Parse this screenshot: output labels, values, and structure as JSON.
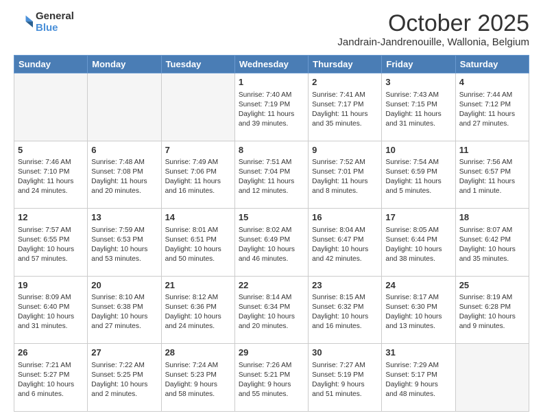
{
  "header": {
    "logo_general": "General",
    "logo_blue": "Blue",
    "month_title": "October 2025",
    "location": "Jandrain-Jandrenouille, Wallonia, Belgium"
  },
  "days_of_week": [
    "Sunday",
    "Monday",
    "Tuesday",
    "Wednesday",
    "Thursday",
    "Friday",
    "Saturday"
  ],
  "weeks": [
    [
      {
        "day": "",
        "info": ""
      },
      {
        "day": "",
        "info": ""
      },
      {
        "day": "",
        "info": ""
      },
      {
        "day": "1",
        "info": "Sunrise: 7:40 AM\nSunset: 7:19 PM\nDaylight: 11 hours\nand 39 minutes."
      },
      {
        "day": "2",
        "info": "Sunrise: 7:41 AM\nSunset: 7:17 PM\nDaylight: 11 hours\nand 35 minutes."
      },
      {
        "day": "3",
        "info": "Sunrise: 7:43 AM\nSunset: 7:15 PM\nDaylight: 11 hours\nand 31 minutes."
      },
      {
        "day": "4",
        "info": "Sunrise: 7:44 AM\nSunset: 7:12 PM\nDaylight: 11 hours\nand 27 minutes."
      }
    ],
    [
      {
        "day": "5",
        "info": "Sunrise: 7:46 AM\nSunset: 7:10 PM\nDaylight: 11 hours\nand 24 minutes."
      },
      {
        "day": "6",
        "info": "Sunrise: 7:48 AM\nSunset: 7:08 PM\nDaylight: 11 hours\nand 20 minutes."
      },
      {
        "day": "7",
        "info": "Sunrise: 7:49 AM\nSunset: 7:06 PM\nDaylight: 11 hours\nand 16 minutes."
      },
      {
        "day": "8",
        "info": "Sunrise: 7:51 AM\nSunset: 7:04 PM\nDaylight: 11 hours\nand 12 minutes."
      },
      {
        "day": "9",
        "info": "Sunrise: 7:52 AM\nSunset: 7:01 PM\nDaylight: 11 hours\nand 8 minutes."
      },
      {
        "day": "10",
        "info": "Sunrise: 7:54 AM\nSunset: 6:59 PM\nDaylight: 11 hours\nand 5 minutes."
      },
      {
        "day": "11",
        "info": "Sunrise: 7:56 AM\nSunset: 6:57 PM\nDaylight: 11 hours\nand 1 minute."
      }
    ],
    [
      {
        "day": "12",
        "info": "Sunrise: 7:57 AM\nSunset: 6:55 PM\nDaylight: 10 hours\nand 57 minutes."
      },
      {
        "day": "13",
        "info": "Sunrise: 7:59 AM\nSunset: 6:53 PM\nDaylight: 10 hours\nand 53 minutes."
      },
      {
        "day": "14",
        "info": "Sunrise: 8:01 AM\nSunset: 6:51 PM\nDaylight: 10 hours\nand 50 minutes."
      },
      {
        "day": "15",
        "info": "Sunrise: 8:02 AM\nSunset: 6:49 PM\nDaylight: 10 hours\nand 46 minutes."
      },
      {
        "day": "16",
        "info": "Sunrise: 8:04 AM\nSunset: 6:47 PM\nDaylight: 10 hours\nand 42 minutes."
      },
      {
        "day": "17",
        "info": "Sunrise: 8:05 AM\nSunset: 6:44 PM\nDaylight: 10 hours\nand 38 minutes."
      },
      {
        "day": "18",
        "info": "Sunrise: 8:07 AM\nSunset: 6:42 PM\nDaylight: 10 hours\nand 35 minutes."
      }
    ],
    [
      {
        "day": "19",
        "info": "Sunrise: 8:09 AM\nSunset: 6:40 PM\nDaylight: 10 hours\nand 31 minutes."
      },
      {
        "day": "20",
        "info": "Sunrise: 8:10 AM\nSunset: 6:38 PM\nDaylight: 10 hours\nand 27 minutes."
      },
      {
        "day": "21",
        "info": "Sunrise: 8:12 AM\nSunset: 6:36 PM\nDaylight: 10 hours\nand 24 minutes."
      },
      {
        "day": "22",
        "info": "Sunrise: 8:14 AM\nSunset: 6:34 PM\nDaylight: 10 hours\nand 20 minutes."
      },
      {
        "day": "23",
        "info": "Sunrise: 8:15 AM\nSunset: 6:32 PM\nDaylight: 10 hours\nand 16 minutes."
      },
      {
        "day": "24",
        "info": "Sunrise: 8:17 AM\nSunset: 6:30 PM\nDaylight: 10 hours\nand 13 minutes."
      },
      {
        "day": "25",
        "info": "Sunrise: 8:19 AM\nSunset: 6:28 PM\nDaylight: 10 hours\nand 9 minutes."
      }
    ],
    [
      {
        "day": "26",
        "info": "Sunrise: 7:21 AM\nSunset: 5:27 PM\nDaylight: 10 hours\nand 6 minutes."
      },
      {
        "day": "27",
        "info": "Sunrise: 7:22 AM\nSunset: 5:25 PM\nDaylight: 10 hours\nand 2 minutes."
      },
      {
        "day": "28",
        "info": "Sunrise: 7:24 AM\nSunset: 5:23 PM\nDaylight: 9 hours\nand 58 minutes."
      },
      {
        "day": "29",
        "info": "Sunrise: 7:26 AM\nSunset: 5:21 PM\nDaylight: 9 hours\nand 55 minutes."
      },
      {
        "day": "30",
        "info": "Sunrise: 7:27 AM\nSunset: 5:19 PM\nDaylight: 9 hours\nand 51 minutes."
      },
      {
        "day": "31",
        "info": "Sunrise: 7:29 AM\nSunset: 5:17 PM\nDaylight: 9 hours\nand 48 minutes."
      },
      {
        "day": "",
        "info": ""
      }
    ]
  ]
}
